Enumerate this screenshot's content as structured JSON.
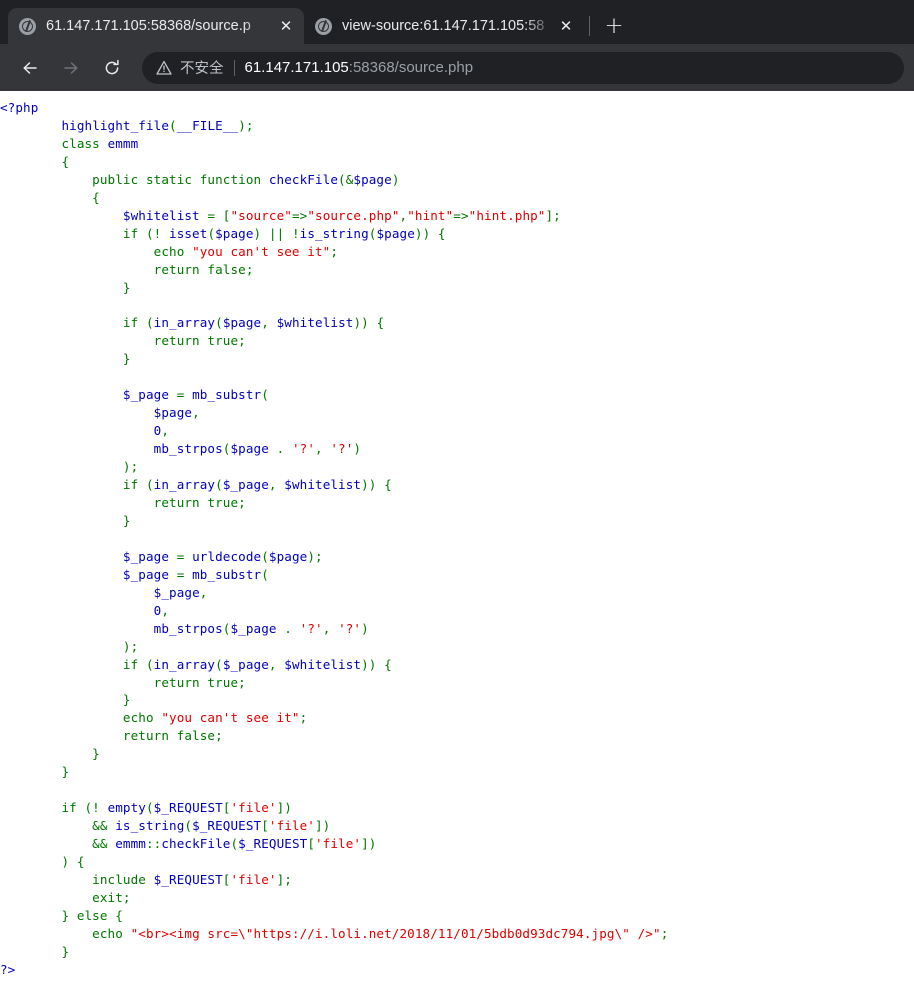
{
  "browser": {
    "tabs": [
      {
        "title": "61.147.171.105:58368/source.p",
        "favicon": "globe-icon",
        "close": "✕",
        "active": true
      },
      {
        "title": "view-source:61.147.171.105:58",
        "favicon": "globe-icon",
        "close": "✕",
        "active": false
      }
    ],
    "new_tab_label": "+",
    "nav": {
      "back": "back-arrow",
      "forward": "forward-arrow",
      "reload": "reload-arrow"
    },
    "omnibox": {
      "security_icon": "warning-triangle-icon",
      "security_text": "不安全",
      "url_host": "61.147.171.105",
      "url_rest": ":58368/source.php",
      "full_url": "61.147.171.105:58368/source.php"
    },
    "colors": {
      "tabstrip_bg": "#202124",
      "active_tab_bg": "#35363a",
      "toolbar_bg": "#35363a",
      "omnibox_bg": "#202124",
      "tab_text": "#e8eaed",
      "url_host_text": "#ffffff",
      "url_rest_text": "#9aa0a6"
    }
  },
  "source": {
    "language": "php",
    "filename": "source.php",
    "highlight_colors": {
      "keyword": "#007700",
      "string": "#DD0000",
      "default": "#0000BB",
      "comment": "#FF8000",
      "html": "#000000"
    },
    "code_lines": [
      "<?php",
      "        highlight_file(__FILE__);",
      "        class emmm",
      "        {",
      "            public static function checkFile(&$page)",
      "            {",
      "                $whitelist = [\"source\"=>\"source.php\",\"hint\"=>\"hint.php\"];",
      "                if (! isset($page) || !is_string($page)) {",
      "                    echo \"you can't see it\";",
      "                    return false;",
      "                }",
      "",
      "                if (in_array($page, $whitelist)) {",
      "                    return true;",
      "                }",
      "",
      "                $_page = mb_substr(",
      "                    $page,",
      "                    0,",
      "                    mb_strpos($page . '?', '?')",
      "                );",
      "                if (in_array($_page, $whitelist)) {",
      "                    return true;",
      "                }",
      "",
      "                $_page = urldecode($page);",
      "                $_page = mb_substr(",
      "                    $_page,",
      "                    0,",
      "                    mb_strpos($_page . '?', '?')",
      "                );",
      "                if (in_array($_page, $whitelist)) {",
      "                    return true;",
      "                }",
      "                echo \"you can't see it\";",
      "                return false;",
      "            }",
      "        }",
      "",
      "        if (! empty($_REQUEST['file'])",
      "            && is_string($_REQUEST['file'])",
      "            && emmm::checkFile($_REQUEST['file'])",
      "        ) {",
      "            include $_REQUEST['file'];",
      "            exit;",
      "        } else {",
      "            echo \"<br><img src=\\\"https://i.loli.net/2018/11/01/5bdb0d93dc794.jpg\\\" />\";",
      "        }",
      "?>"
    ],
    "code_html": "<span class=\"d\">&lt;?php<br /></span><span class=\"k\">        </span><span class=\"d\">highlight_file</span><span class=\"k\">(</span><span class=\"d\">__FILE__</span><span class=\"k\">);<br />        class </span><span class=\"d\">emmm<br />        </span><span class=\"k\">{<br />            public static function </span><span class=\"d\">checkFile</span><span class=\"k\">(&amp;</span><span class=\"d\">$page</span><span class=\"k\">)<br />            {<br />                </span><span class=\"d\">$whitelist </span><span class=\"k\">= [</span><span class=\"s\">\"source\"</span><span class=\"k\">=&gt;</span><span class=\"s\">\"source.php\"</span><span class=\"k\">,</span><span class=\"s\">\"hint\"</span><span class=\"k\">=&gt;</span><span class=\"s\">\"hint.php\"</span><span class=\"k\">];<br />                if (! </span><span class=\"d\">isset</span><span class=\"k\">(</span><span class=\"d\">$page</span><span class=\"k\">) || !</span><span class=\"d\">is_string</span><span class=\"k\">(</span><span class=\"d\">$page</span><span class=\"k\">)) {<br />                    echo </span><span class=\"s\">\"you can't see it\"</span><span class=\"k\">;<br />                    return false;<br />                }<br /><br />                if (</span><span class=\"d\">in_array</span><span class=\"k\">(</span><span class=\"d\">$page</span><span class=\"k\">, </span><span class=\"d\">$whitelist</span><span class=\"k\">)) {<br />                    return true;<br />                }<br /><br />                </span><span class=\"d\">$_page </span><span class=\"k\">= </span><span class=\"d\">mb_substr</span><span class=\"k\">(<br />                    </span><span class=\"d\">$page</span><span class=\"k\">,<br />                    </span><span class=\"d\">0</span><span class=\"k\">,<br />                    </span><span class=\"d\">mb_strpos</span><span class=\"k\">(</span><span class=\"d\">$page </span><span class=\"k\">. </span><span class=\"s\">'?'</span><span class=\"k\">, </span><span class=\"s\">'?'</span><span class=\"k\">)<br />                );<br />                if (</span><span class=\"d\">in_array</span><span class=\"k\">(</span><span class=\"d\">$_page</span><span class=\"k\">, </span><span class=\"d\">$whitelist</span><span class=\"k\">)) {<br />                    return true;<br />                }<br /><br />                </span><span class=\"d\">$_page </span><span class=\"k\">= </span><span class=\"d\">urldecode</span><span class=\"k\">(</span><span class=\"d\">$page</span><span class=\"k\">);<br />                </span><span class=\"d\">$_page </span><span class=\"k\">= </span><span class=\"d\">mb_substr</span><span class=\"k\">(<br />                    </span><span class=\"d\">$_page</span><span class=\"k\">,<br />                    </span><span class=\"d\">0</span><span class=\"k\">,<br />                    </span><span class=\"d\">mb_strpos</span><span class=\"k\">(</span><span class=\"d\">$_page </span><span class=\"k\">. </span><span class=\"s\">'?'</span><span class=\"k\">, </span><span class=\"s\">'?'</span><span class=\"k\">)<br />                );<br />                if (</span><span class=\"d\">in_array</span><span class=\"k\">(</span><span class=\"d\">$_page</span><span class=\"k\">, </span><span class=\"d\">$whitelist</span><span class=\"k\">)) {<br />                    return true;<br />                }<br />                echo </span><span class=\"s\">\"you can't see it\"</span><span class=\"k\">;<br />                return false;<br />            }<br />        }<br /><br />        if (! </span><span class=\"d\">empty</span><span class=\"k\">(</span><span class=\"d\">$_REQUEST</span><span class=\"k\">[</span><span class=\"s\">'file'</span><span class=\"k\">])<br />            &amp;&amp; </span><span class=\"d\">is_string</span><span class=\"k\">(</span><span class=\"d\">$_REQUEST</span><span class=\"k\">[</span><span class=\"s\">'file'</span><span class=\"k\">])<br />            &amp;&amp; </span><span class=\"d\">emmm</span><span class=\"k\">::</span><span class=\"d\">checkFile</span><span class=\"k\">(</span><span class=\"d\">$_REQUEST</span><span class=\"k\">[</span><span class=\"s\">'file'</span><span class=\"k\">])<br />        ) {<br />            include </span><span class=\"d\">$_REQUEST</span><span class=\"k\">[</span><span class=\"s\">'file'</span><span class=\"k\">];<br />            exit;<br />        } else {<br />            echo </span><span class=\"s\">\"&lt;br&gt;&lt;img src=\\\"https://i.loli.net/2018/11/01/5bdb0d93dc794.jpg\\\" /&gt;\"</span><span class=\"k\">;<br />        }<br /></span><span class=\"d\">?&gt;</span>"
  }
}
